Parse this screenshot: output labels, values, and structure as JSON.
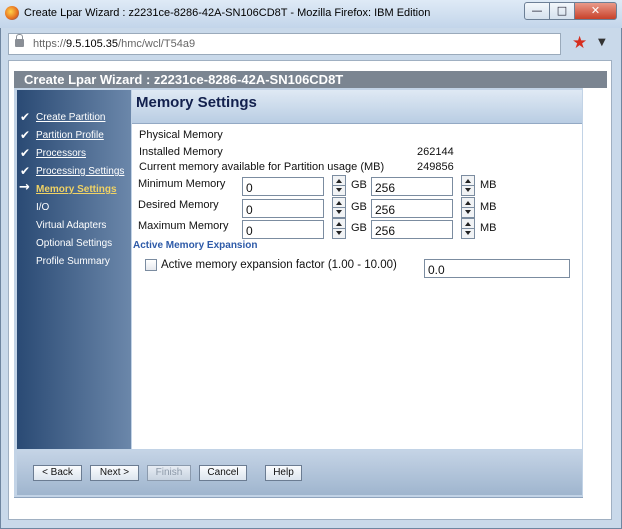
{
  "window": {
    "title": "Create Lpar Wizard : z2231ce-8286-42A-SN106CD8T - Mozilla Firefox: IBM Edition",
    "controls": {
      "minimize": "—",
      "maximize": "□",
      "close": "✕"
    }
  },
  "browser": {
    "url_scheme": "https://",
    "url_host": "9.5.105.35",
    "url_path": "/hmc/wcl/T54a9"
  },
  "wizard": {
    "header": "Create Lpar Wizard : z2231ce-8286-42A-SN106CD8T",
    "nav": [
      {
        "label": "Create Partition",
        "state": "done"
      },
      {
        "label": "Partition Profile",
        "state": "done"
      },
      {
        "label": "Processors",
        "state": "done"
      },
      {
        "label": "Processing Settings",
        "state": "done"
      },
      {
        "label": "Memory Settings",
        "state": "current"
      },
      {
        "label": "I/O",
        "state": "todo"
      },
      {
        "label": "Virtual Adapters",
        "state": "todo"
      },
      {
        "label": "Optional Settings",
        "state": "todo"
      },
      {
        "label": "Profile Summary",
        "state": "todo"
      }
    ],
    "page_title": "Memory Settings",
    "physical_memory_label": "Physical Memory",
    "installed_label": "Installed Memory",
    "installed_value": "262144",
    "available_label": "Current memory available for Partition usage (MB)",
    "available_value": "249856",
    "rows": [
      {
        "label": "Minimum Memory",
        "gb": "0",
        "gb_unit": "GB",
        "mb": "256",
        "mb_unit": "MB"
      },
      {
        "label": "Desired Memory",
        "gb": "0",
        "gb_unit": "GB",
        "mb": "256",
        "mb_unit": "MB"
      },
      {
        "label": "Maximum Memory",
        "gb": "0",
        "gb_unit": "GB",
        "mb": "256",
        "mb_unit": "MB"
      }
    ],
    "ame_section_title": "Active Memory Expansion",
    "ame_checkbox_label": "Active memory expansion factor (1.00 - 10.00)",
    "ame_checked": false,
    "ame_value": "0.0",
    "buttons": {
      "back": "< Back",
      "next": "Next >",
      "finish": "Finish",
      "cancel": "Cancel",
      "help": "Help"
    }
  },
  "colors": {
    "nav_current": "#f0d264",
    "section_title": "#2d5aa8",
    "close_button": "#c8412a"
  }
}
